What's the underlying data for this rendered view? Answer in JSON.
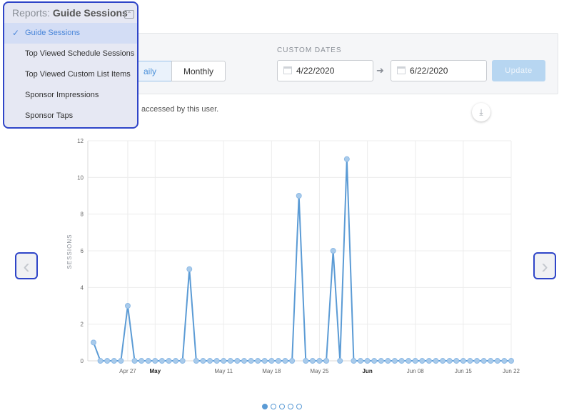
{
  "report_selector": {
    "prefix": "Reports:",
    "current": "Guide Sessions",
    "options": [
      {
        "label": "Guide Sessions",
        "selected": true
      },
      {
        "label": "Top Viewed Schedule Sessions",
        "selected": false
      },
      {
        "label": "Top Viewed Custom List Items",
        "selected": false
      },
      {
        "label": "Sponsor Impressions",
        "selected": false
      },
      {
        "label": "Sponsor Taps",
        "selected": false
      }
    ]
  },
  "filters": {
    "range_buttons": {
      "daily": "aily",
      "monthly": "Monthly"
    },
    "selected_range": "daily",
    "custom_dates_label": "CUSTOM DATES",
    "start_date": "4/22/2020",
    "end_date": "6/22/2020",
    "update_label": "Update"
  },
  "subtitle": "accessed by this user.",
  "icons": {
    "download": "download-icon",
    "prev": "chevron-left-icon",
    "next": "chevron-right-icon",
    "calendar": "calendar-icon"
  },
  "colors": {
    "accent": "#5b9bd5",
    "highlight_border": "#2f45c8",
    "update_disabled": "#b7d6f1"
  },
  "pager": {
    "pages": 5,
    "active": 0
  },
  "chart_data": {
    "type": "line",
    "ylabel": "SESSIONS",
    "ylim": [
      0,
      12
    ],
    "yticks": [
      0,
      2,
      4,
      6,
      8,
      10,
      12
    ],
    "x_start": "2020-04-22",
    "x_end": "2020-06-22",
    "xtick_labels": [
      {
        "label": "Apr 27",
        "day_index": 5,
        "bold": false
      },
      {
        "label": "May",
        "day_index": 9,
        "bold": true
      },
      {
        "label": "May 11",
        "day_index": 19,
        "bold": false
      },
      {
        "label": "May 18",
        "day_index": 26,
        "bold": false
      },
      {
        "label": "May 25",
        "day_index": 33,
        "bold": false
      },
      {
        "label": "Jun",
        "day_index": 40,
        "bold": true
      },
      {
        "label": "Jun 08",
        "day_index": 47,
        "bold": false
      },
      {
        "label": "Jun 15",
        "day_index": 54,
        "bold": false
      },
      {
        "label": "Jun 22",
        "day_index": 61,
        "bold": false
      }
    ],
    "series": [
      {
        "values": [
          1,
          0,
          0,
          0,
          0,
          3,
          0,
          0,
          0,
          0,
          0,
          0,
          0,
          0,
          5,
          0,
          0,
          0,
          0,
          0,
          0,
          0,
          0,
          0,
          0,
          0,
          0,
          0,
          0,
          0,
          9,
          0,
          0,
          0,
          0,
          6,
          0,
          11,
          0,
          0,
          0,
          0,
          0,
          0,
          0,
          0,
          0,
          0,
          0,
          0,
          0,
          0,
          0,
          0,
          0,
          0,
          0,
          0,
          0,
          0,
          0,
          0
        ]
      }
    ],
    "grid": true
  }
}
